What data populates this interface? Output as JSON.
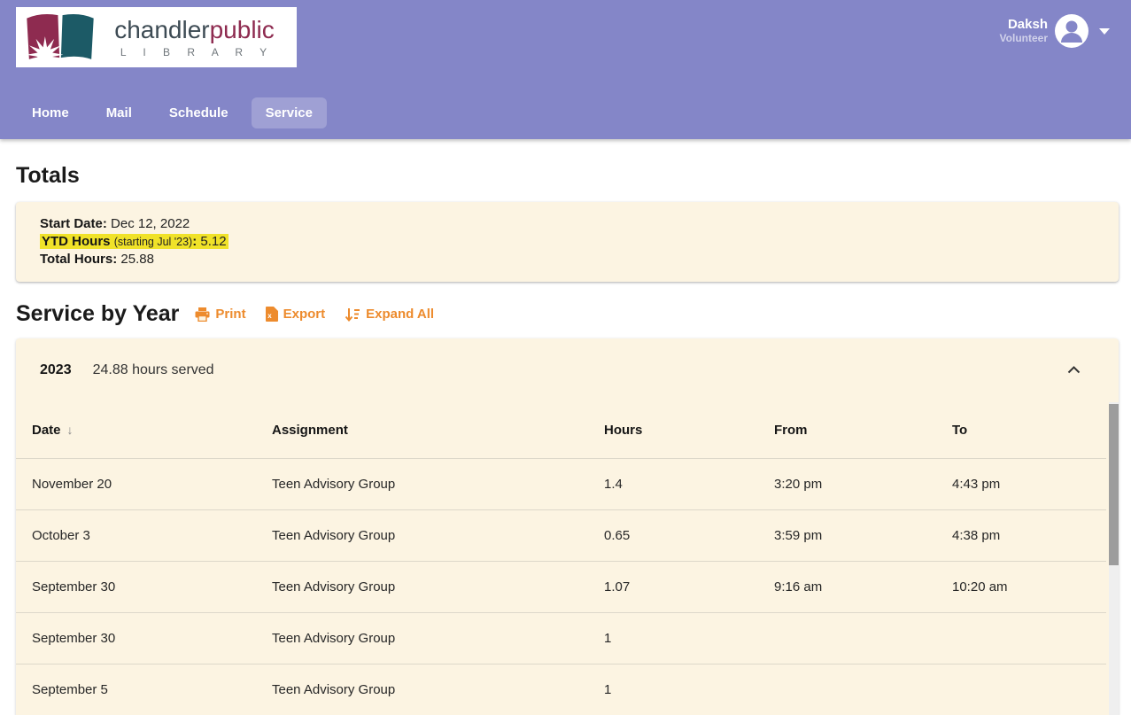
{
  "colors": {
    "header_purple": "#8486c8",
    "card_cream": "#fcf4e2",
    "highlight_yellow": "#f0e229",
    "link_orange": "#ed8b2d",
    "logo_maroon": "#8e2b50",
    "logo_teal": "#1c5a66"
  },
  "header": {
    "logo": {
      "name_part1": "chandler",
      "name_part2": "public",
      "subtitle": "L I B R A R Y"
    },
    "user": {
      "name": "Daksh",
      "role": "Volunteer"
    },
    "nav": [
      {
        "label": "Home"
      },
      {
        "label": "Mail"
      },
      {
        "label": "Schedule"
      },
      {
        "label": "Service"
      }
    ]
  },
  "totals": {
    "heading": "Totals",
    "start": {
      "label": "Start Date:",
      "value": "Dec 12, 2022"
    },
    "ytd": {
      "label": "YTD Hours",
      "note": "(starting Jul '23)",
      "colon": ":",
      "value": "5.12"
    },
    "total": {
      "label": "Total Hours:",
      "value": "25.88"
    }
  },
  "service": {
    "heading": "Service by Year",
    "actions": {
      "print": "Print",
      "export": "Export",
      "expand_all": "Expand All"
    },
    "year": {
      "label": "2023",
      "summary": "24.88 hours served"
    },
    "table": {
      "columns": [
        "Date",
        "Assignment",
        "Hours",
        "From",
        "To"
      ],
      "sort_arrow_glyph": "↓",
      "rows": [
        {
          "date": "November 20",
          "assignment": "Teen Advisory Group",
          "hours": "1.4",
          "from": "3:20 pm",
          "to": "4:43 pm"
        },
        {
          "date": "October 3",
          "assignment": "Teen Advisory Group",
          "hours": "0.65",
          "from": "3:59 pm",
          "to": "4:38 pm"
        },
        {
          "date": "September 30",
          "assignment": "Teen Advisory Group",
          "hours": "1.07",
          "from": "9:16 am",
          "to": "10:20 am"
        },
        {
          "date": "September 30",
          "assignment": "Teen Advisory Group",
          "hours": "1",
          "from": "",
          "to": ""
        },
        {
          "date": "September 5",
          "assignment": "Teen Advisory Group",
          "hours": "1",
          "from": "",
          "to": ""
        }
      ]
    }
  }
}
